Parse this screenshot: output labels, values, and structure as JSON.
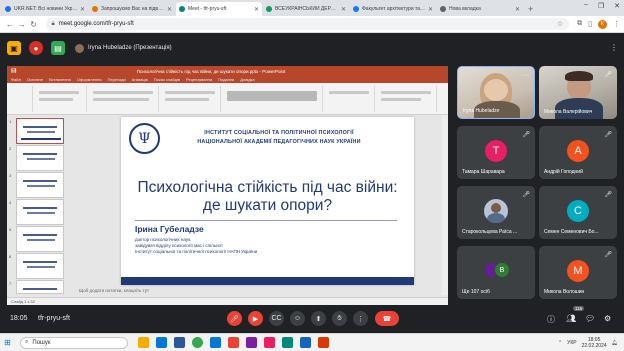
{
  "browser": {
    "tabs": [
      {
        "title": "UKR.NET: Всі новини України",
        "fav_color": "#1a73e8"
      },
      {
        "title": "Запрошуємо Вас на підвищення",
        "fav_color": "#e37400"
      },
      {
        "title": "Meet - tfr-pryu-sft",
        "fav_color": "#00897b",
        "active": true
      },
      {
        "title": "ВСЕУКРАЇНСЬКИЙ ДЕРЖАВНИЙ",
        "fav_color": "#0f9d58"
      },
      {
        "title": "Факультет архітектури та дизайну",
        "fav_color": "#1877f2"
      },
      {
        "title": "Нова вкладка",
        "fav_color": "#5f6368"
      }
    ],
    "new_tab": "+",
    "window_controls": [
      "−",
      "❐",
      "✕"
    ],
    "url": "meet.google.com/tfr-pryu-sft",
    "profile_initial": "К"
  },
  "meet": {
    "presenter_label": "Iryna Hubeladze (Презентація)",
    "meeting_code": "tfr-pryu-sft",
    "clock": "18:05",
    "participants": [
      {
        "name": "Iryna Hubeladze",
        "type": "video1"
      },
      {
        "name": "Микола Валерійович",
        "type": "video2"
      },
      {
        "name": "Тамара Шараварa",
        "initial": "Т",
        "color": "#e91e63"
      },
      {
        "name": "Андрій Гоподний",
        "initial": "А",
        "color": "#f4511e"
      },
      {
        "name": "Старокольцева Раїса ...",
        "type": "photo"
      },
      {
        "name": "Семен Семенович Бо...",
        "initial": "С",
        "color": "#00acc1"
      },
      {
        "name": "Ще 107 осіб",
        "type": "stack"
      },
      {
        "name": "Микола Волошин",
        "initial": "М",
        "color": "#f4511e"
      }
    ],
    "more_people_initials": [
      "В"
    ],
    "people_badge": "116"
  },
  "powerpoint": {
    "window_title": "Психологічна стійкість під час війни, де шукати опори.pptx - PowerPoint",
    "menu": [
      "Файл",
      "Основне",
      "Вставлення",
      "Оформлення",
      "Переходи",
      "Анімація",
      "Показ слайдів",
      "Рецензування",
      "Подання",
      "Довідка"
    ],
    "slide_numbers": [
      "1",
      "2",
      "3",
      "4",
      "5",
      "6",
      "7"
    ],
    "notes_placeholder": "Щоб додати нотатки, клацніть тут",
    "status_text": "Слайд 1 з 32",
    "slide": {
      "institute_line1": "ІНСТИТУТ СОЦІАЛЬНОЇ ТА ПОЛІТИЧНОЇ ПСИХОЛОГІЇ",
      "institute_line2": "НАЦІОНАЛЬНОЇ АКАДЕМІЇ ПЕДАГОГІЧНИХ НАУК УКРАЇНИ",
      "logo_glyph": "Ψ",
      "title_line1": "Психологічна стійкість під час війни:",
      "title_line2": "де шукати опори?",
      "author": "Ірина Губеладзе",
      "cred1": "доктор психологічних наук,",
      "cred2": "завідувач відділу психології мас і спільнот",
      "cred3": "Інститут соціальної та політичної психології НАПН України"
    }
  },
  "taskbar": {
    "search_placeholder": "Пошук",
    "lang": "УКР",
    "time": "18:05",
    "date": "22.02.2024",
    "apps": [
      "#f9ab00",
      "#0078d4",
      "#2b579a",
      "#34a853",
      "#0078d4",
      "#ea4335",
      "#7b1fa2",
      "#e91e63",
      "#00897b",
      "#1565c0",
      "#d83b01"
    ]
  }
}
